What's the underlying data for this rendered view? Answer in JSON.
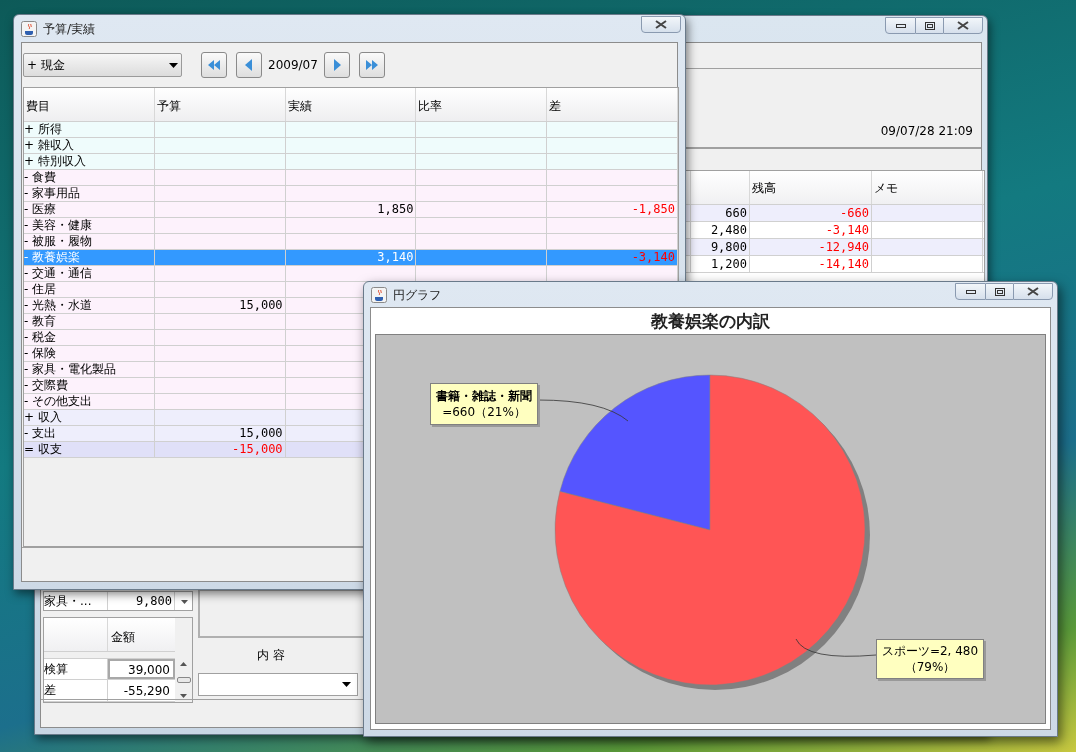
{
  "main_window": {
    "timestamp": "09/07/28 21:09",
    "ledger": {
      "columns": [
        "残高",
        "メモ"
      ],
      "rows": [
        {
          "column_1": "660",
          "balance": "-660",
          "balance_negative": true
        },
        {
          "column_1": "2,480",
          "balance": "-3,140",
          "balance_negative": true
        },
        {
          "column_1": "9,800",
          "balance": "-12,940",
          "balance_negative": true
        },
        {
          "column_1": "1,200",
          "balance": "-14,140",
          "balance_negative": true
        }
      ]
    },
    "category_table": {
      "rows": [
        {
          "label": "家具・...",
          "amount": "9,800"
        }
      ]
    },
    "totals_table": {
      "header": "金額",
      "rows": [
        {
          "label": "検算",
          "amount": "39,000",
          "focused": true
        },
        {
          "label": "差",
          "amount": "-55,290",
          "focused": false
        }
      ]
    },
    "content_label": "内 容"
  },
  "budget_window": {
    "title": "予算/実績",
    "account": "+ 現金",
    "period": "2009/07",
    "columns": [
      "費目",
      "予算",
      "実績",
      "比率",
      "差"
    ],
    "rows": [
      {
        "label": "+ 所得",
        "kind": "income",
        "selected": false
      },
      {
        "label": "+ 雑収入",
        "kind": "income",
        "selected": false
      },
      {
        "label": "+ 特別収入",
        "kind": "income",
        "selected": false
      },
      {
        "label": "- 食費",
        "kind": "expense",
        "selected": false
      },
      {
        "label": "- 家事用品",
        "kind": "expense",
        "selected": false
      },
      {
        "label": "- 医療",
        "kind": "expense",
        "selected": false,
        "actual": "1,850",
        "diff": "-1,850",
        "diff_negative": true
      },
      {
        "label": "- 美容・健康",
        "kind": "expense",
        "selected": false
      },
      {
        "label": "- 被服・履物",
        "kind": "expense",
        "selected": false
      },
      {
        "label": "- 教養娯楽",
        "selected": true,
        "actual": "3,140",
        "diff": "-3,140",
        "diff_negative": true
      },
      {
        "label": "- 交通・通信",
        "kind": "expense",
        "selected": false
      },
      {
        "label": "- 住居",
        "kind": "expense",
        "selected": false
      },
      {
        "label": "- 光熱・水道",
        "kind": "expense",
        "selected": false,
        "budget": "15,000"
      },
      {
        "label": "- 教育",
        "kind": "expense",
        "selected": false
      },
      {
        "label": "- 税金",
        "kind": "expense",
        "selected": false
      },
      {
        "label": "- 保険",
        "kind": "expense",
        "selected": false
      },
      {
        "label": "- 家具・電化製品",
        "kind": "expense",
        "selected": false
      },
      {
        "label": "- 交際費",
        "kind": "expense",
        "selected": false
      },
      {
        "label": "- その他支出",
        "kind": "expense",
        "selected": false
      },
      {
        "label": "+ 収入",
        "kind": "summary",
        "selected": false
      },
      {
        "label": "- 支出",
        "kind": "summary",
        "selected": false,
        "budget": "15,000"
      },
      {
        "label": "= 収支",
        "kind": "total",
        "selected": false,
        "budget": "-15,000",
        "budget_negative": true
      }
    ]
  },
  "pie_window": {
    "title": "円グラフ",
    "chart_data": {
      "type": "pie",
      "title": "教養娯楽の内訳",
      "categories": [
        "書籍・雑誌・新聞",
        "スポーツ"
      ],
      "values": [
        21,
        79
      ],
      "colors": [
        "#5555ff",
        "#ff5555"
      ],
      "value_labels": [
        {
          "value": "=660",
          "share": "（21%）"
        },
        {
          "value": "=2, 480",
          "share": "（79%）"
        }
      ]
    }
  }
}
